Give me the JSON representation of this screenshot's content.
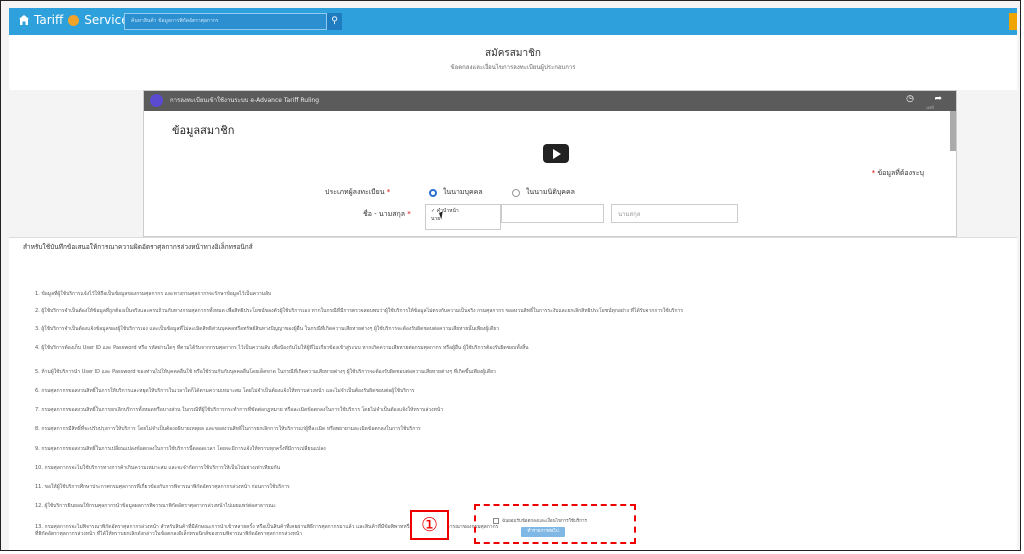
{
  "header": {
    "brand": "Tariff",
    "brand_suffix": "Service",
    "search_placeholder": "ค้นหาสินค้า ข้อมูลการพิกัดอัตราศุลกากร"
  },
  "page": {
    "title": "สมัครสมาชิก",
    "subtitle": "ข้อตกลงและเงื่อนไขการลงทะเบียนผู้ประกอบการ"
  },
  "video": {
    "title": "การลงทะเบียนเข้าใช้งานระบบ e-Advance Tariff Ruling",
    "share_label": "แชร์"
  },
  "member_form": {
    "section_title": "ข้อมูลสมาชิก",
    "required_note": "ข้อมูลที่ต้องระบุ",
    "registrant_type_label": "ประเภทผู้ลงทะเบียน",
    "option_individual": "ในนามบุคคล",
    "option_juristic": "ในนามนิติบุคคล",
    "name_label": "ชื่อ - นามสกุล",
    "prefix_selected": "คำนำหน้า",
    "prefix_option2": "นาย",
    "lastname_placeholder": "นามสกุล"
  },
  "terms_modal": {
    "title": "สำหรับใช้บันทึกข้อเสนอให้การณาความผิดอัตราศุลกากรล่วงหน้าทางอิเล็กทรอนิกส์",
    "items": [
      "1. ข้อมูลที่ผู้ใช้บริการแจ้งไว้ให้ถือเป็นข้อมูลของกรมศุลกากร และทางกรมศุลกากรจะรักษาข้อมูลไว้เป็นความลับ",
      "2. ผู้ใช้บริการจำเป็นต้องให้ข้อมูลที่ถูกต้องเป็นจริงและครบถ้วนกับทางกรมศุลกากรทั้งหมด เพื่อสิทธิประโยชน์ของตัวผู้ใช้บริการเอง หากในกรณีที่มีการตรวจสอบพบว่าผู้ใช้บริการให้ข้อมูลไม่ตรงกับความเป็นจริง กรมศุลกากร ขอสงวนสิทธิ์ในการระงับและยกเลิกสิทธิประโยชน์ทุกอย่าง ที่ได้รับจากการใช้บริการ",
      "3. ผู้ใช้บริการจำเป็นต้องแจ้งข้อมูลของผู้ใช้บริการเอง และเป็นข้อมูลที่ไม่ละเมิดสิทธิส่วนบุคคลหรือทรัพย์สินทางปัญญาของผู้อื่น ในกรณีที่เกิดความเสียหายต่างๆ ผู้ใช้บริการจะต้องรับผิดชอบต่อความเสียหายนั้นเพียงผู้เดียว",
      "4. ผู้ใช้บริการต้องเก็บ User ID และ Password หรือ รหัสผ่านใดๆ ที่ตามได้รับจากกรมศุลกากร ไว้เป็นความลับ เพื่อป้องกันไม่ให้ผู้ที่ไม่เกี่ยวข้องเข้าสู่ระบบ หากเกิดความเสียหายต่อกรมศุลกากร หรือผู้อื่น ผู้ใช้บริการต้องรับผิดชอบทั้งสิ้น",
      "5. ห้ามผู้ใช้บริการนำ User ID และ Password ของท่านไปให้บุคคลอื่นใช้ หรือใช้ร่วมกันกับบุคคลอื่นโดยเด็ดขาด ในกรณีที่เกิดความเสียหายต่างๆ ผู้ใช้บริการจะต้องรับผิดชอบต่อความเสียหายต่างๆ ที่เกิดขึ้นเพียงผู้เดียว",
      "6. กรมศุลกากรขอสงวนสิทธิ์ในการให้บริการและหยุดให้บริการในเวลาใดก็ได้ตามความเหมาะสม โดยไม่จำเป็นต้องแจ้งให้ทราบล่วงหน้า และไม่จำเป็นต้องรับผิดชอบต่อผู้ใช้บริการ",
      "7. กรมศุลกากรขอสงวนสิทธิ์ในการยกเลิกบริการทั้งหมดหรือบางส่วน ในกรณีที่ผู้ใช้บริการกระทำการที่ขัดต่อกฎหมาย หรือละเมิดข้อตกลงในการใช้บริการ โดยไม่จำเป็นต้องแจ้งให้ทราบล่วงหน้า",
      "8. กรมศุลกากรมีสิทธิ์ที่จะปรับปรุงการให้บริการ โดยไม่จำเป็นต้องอธิบายเหตุผล และขอสงวนสิทธิ์ในการยกเลิกการให้บริการแก่ผู้ที่ละเมิด หรือพยายามละเมิดข้อตกลงในการใช้บริการ",
      "9. กรมศุลกากรขอสงวนสิทธิ์ในการเปลี่ยนแปลงข้อตกลงในการใช้บริการนี้ตลอดเวลา โดยจะมีการแจ้งให้ทราบทุกครั้งที่มีการเปลี่ยนแปลง",
      "10. กรมศุลกากรจะไม่ใช้บริการทางการค้าเกินความเหมาะสม และจะจำกัดการใช้บริการให้เป็นไปอย่างเท่าเทียมกัน",
      "11. ขอให้ผู้ใช้บริการศึกษาประกาศกรมศุลกากรที่เกี่ยวข้องกับการพิจารณาพิกัดอัตราศุลกากรล่วงหน้า ก่อนการใช้บริการ",
      "12. ผู้ใช้บริการยินยอมให้กรมศุลกากรนำข้อมูลผลการพิจารณาพิกัดอัตราศุลกากรล่วงหน้าไปเผยแพร่ต่อสาธารณะ",
      "13. กรมศุลกากรจะไม่พิจารณาพิกัดอัตราศุลกากรล่วงหน้า สำหรับสินค้าที่มีลักษณะการนำเข้าหลายครั้ง หรือเป็นสินค้าที่เคยผ่านพิธีการศุลกากรมาแล้ว และสินค้าที่มีข้อพิพาทหรืออยู่ระหว่างการพิจารณาของกรมศุลกากร",
      "ที่พิกัดอัตราศุลกากรล่วงหน้า ที่ได้ให้ทราบยกเลิกดังกล่าวในข้อตกลงอิเล็กทรอนิกส์ของกรมพิจารณาพิกัดอัตราศุลกากรล่วงหน้า"
    ],
    "consent_label": "ฉันยอมรับข้อตกลงและเงื่อนไขการใช้บริการ",
    "next_button": "ทำรายการต่อไป"
  },
  "annotation": {
    "marker": "①"
  }
}
